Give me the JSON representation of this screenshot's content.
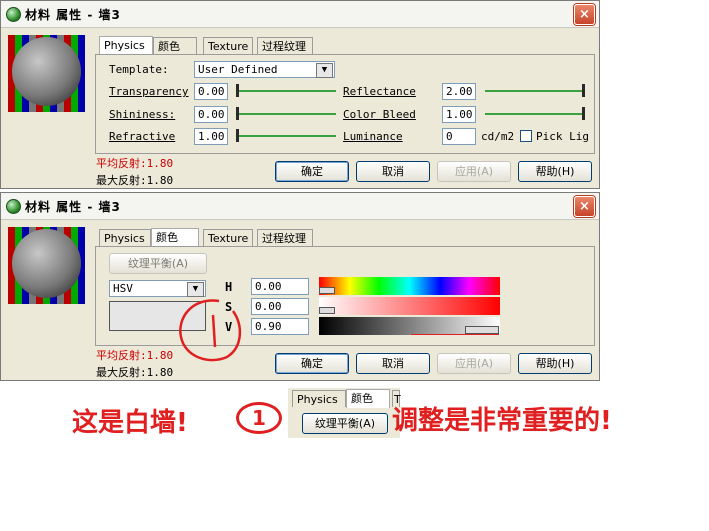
{
  "window1": {
    "title": "材料 属性 - 墙3",
    "close_icon": "×",
    "tabs": [
      "Physics",
      "颜色",
      "Texture",
      "过程纹理"
    ],
    "template_label": "Template:",
    "template_value": "User Defined",
    "rows": [
      {
        "label": "Transparency",
        "value": "0.00"
      },
      {
        "label": "Shininess:",
        "value": "0.00"
      },
      {
        "label": "Refractive",
        "value": "1.00"
      }
    ],
    "right_rows": [
      {
        "label": "Reflectance",
        "value": "2.00"
      },
      {
        "label": "Color Bleed",
        "value": "1.00"
      },
      {
        "label": "Luminance",
        "value": "0",
        "unit": "cd/m2"
      }
    ],
    "pick_label": "Pick Lig",
    "avg_reflect": "平均反射:1.80",
    "max_reflect": "最大反射:1.80",
    "buttons": {
      "ok": "确定",
      "cancel": "取消",
      "apply": "应用(A)",
      "help": "帮助(H)"
    }
  },
  "window2": {
    "title": "材料 属性 - 墙3",
    "close_icon": "×",
    "tabs": [
      "Physics",
      "颜色",
      "Texture",
      "过程纹理"
    ],
    "balance_button": "纹理平衡(A)",
    "mode_value": "HSV",
    "hsv": [
      {
        "label": "H",
        "value": "0.00"
      },
      {
        "label": "S",
        "value": "0.00"
      },
      {
        "label": "V",
        "value": "0.90"
      }
    ],
    "avg_reflect": "平均反射:1.80",
    "max_reflect": "最大反射:1.80",
    "buttons": {
      "ok": "确定",
      "cancel": "取消",
      "apply": "应用(A)",
      "help": "帮助(H)"
    }
  },
  "annotations": {
    "left_text": "这是白墙!",
    "circle_num": "1",
    "right_text": "调整是非常重要的!",
    "mini_tabs": [
      "Physics",
      "颜色",
      "T"
    ],
    "mini_button": "纹理平衡(A)"
  },
  "colors": {
    "annotation_red": "#e02020",
    "status_red": "#cc0000",
    "slider_green": "#3aa040"
  }
}
